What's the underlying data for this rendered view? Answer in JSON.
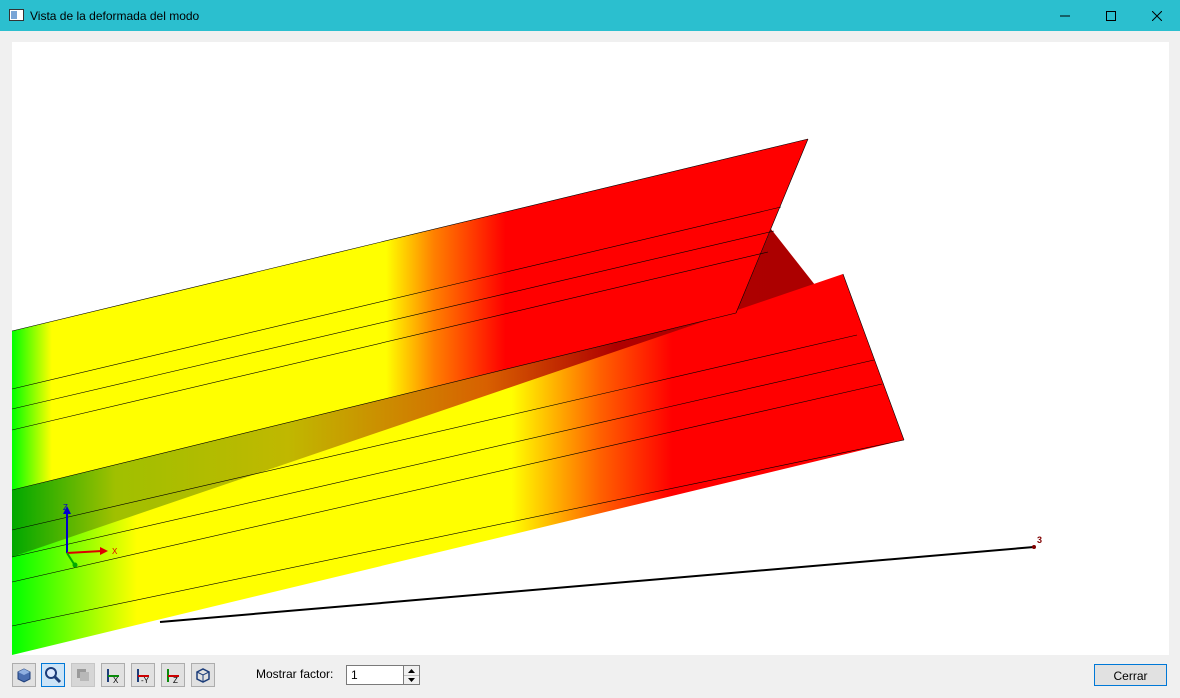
{
  "window": {
    "title": "Vista de la deformada del modo",
    "controls": {
      "minimize_icon": "minimize-icon",
      "maximize_icon": "maximize-icon",
      "close_icon": "close-icon"
    }
  },
  "viewport": {
    "node_label": "3",
    "axes": {
      "x": "X",
      "z": "Z"
    },
    "colors": {
      "low": "#00ff00",
      "mid": "#ffff00",
      "high": "#ff0000",
      "dark": "#aa0000",
      "background": "#ffffff"
    }
  },
  "toolbar": {
    "buttons": [
      {
        "name": "view-3d-button",
        "icon": "cube-view-icon"
      },
      {
        "name": "zoom-button",
        "icon": "magnifier-icon",
        "active": true
      },
      {
        "name": "render-button",
        "icon": "render-icon",
        "disabled": true
      },
      {
        "name": "view-x-button",
        "icon": "axis-x-icon",
        "label": "X"
      },
      {
        "name": "view-y-button",
        "icon": "axis-y-icon",
        "label": "-Y"
      },
      {
        "name": "view-z-button",
        "icon": "axis-z-icon",
        "label": "Z"
      },
      {
        "name": "view-iso-button",
        "icon": "iso-view-icon"
      }
    ]
  },
  "factor": {
    "label": "Mostrar factor:",
    "value": "1"
  },
  "footer": {
    "close_label": "Cerrar"
  }
}
